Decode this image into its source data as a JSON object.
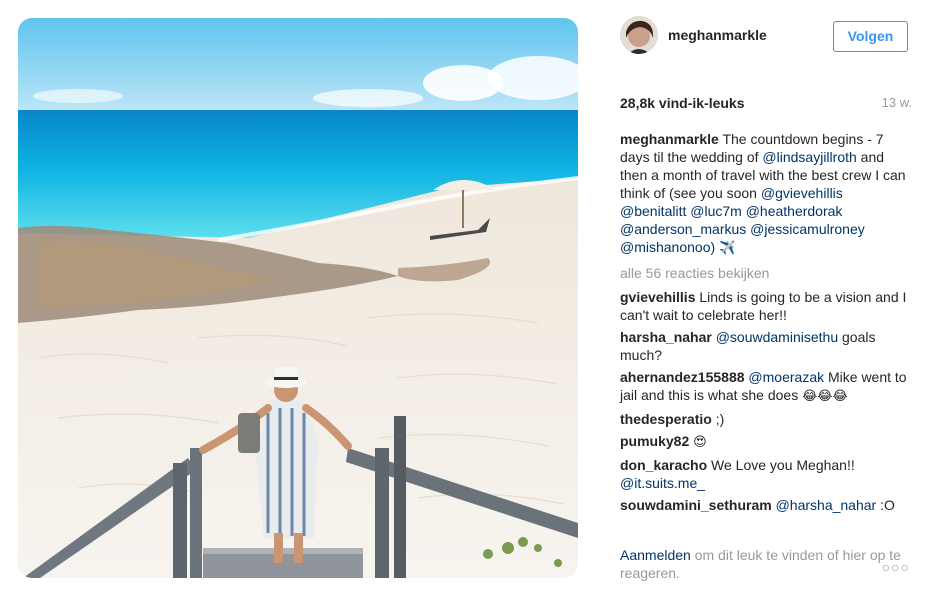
{
  "post": {
    "username": "meghanmarkle",
    "follow_label": "Volgen",
    "likes": "28,8k vind-ik-leuks",
    "time_ago": "13 w."
  },
  "caption": {
    "user": "meghanmarkle",
    "text_1": "The countdown begins - 7 days til the wedding of",
    "mention_1": "@lindsayjillroth",
    "text_2": "and then a month of travel with the best crew I can think of (see you soon",
    "mentions": [
      "@gvievehillis",
      "@benitalitt",
      "@luc7m",
      "@heatherdorak",
      "@anderson_markus",
      "@jessicamulroney",
      "@mishanonoo)"
    ],
    "emoji": "✈️"
  },
  "view_all": "alle 56 reacties bekijken",
  "comments": [
    {
      "user": "gvievehillis",
      "mention": "",
      "text": "Linds is going to be a vision and I can't wait to celebrate her!!",
      "emoji": ""
    },
    {
      "user": "harsha_nahar",
      "mention": "@souwdaminisethu",
      "text": "goals much?",
      "emoji": ""
    },
    {
      "user": "ahernandez155888",
      "mention": "@moerazak",
      "text": "Mike went to jail and this is what she does",
      "emoji": "😂😂😂"
    },
    {
      "user": "thedesperatio",
      "mention": "",
      "text": ";)",
      "emoji": ""
    },
    {
      "user": "pumuky82",
      "mention": "",
      "text": "",
      "emoji": "😍"
    },
    {
      "user": "don_karacho",
      "mention": "",
      "text": "We Love you Meghan!!",
      "emoji": "",
      "mention_after": "@it.suits.me_"
    },
    {
      "user": "souwdamini_sethuram",
      "mention": "@harsha_nahar",
      "text": ":O",
      "emoji": ""
    }
  ],
  "footer": {
    "login_label": "Aanmelden",
    "text": "om dit leuk te vinden of hier op te reageren.",
    "more_label": "○○○"
  },
  "icons": {
    "more": "more-options-icon"
  },
  "colors": {
    "link": "#003569",
    "follow": "#3897f0",
    "muted": "#999999"
  }
}
